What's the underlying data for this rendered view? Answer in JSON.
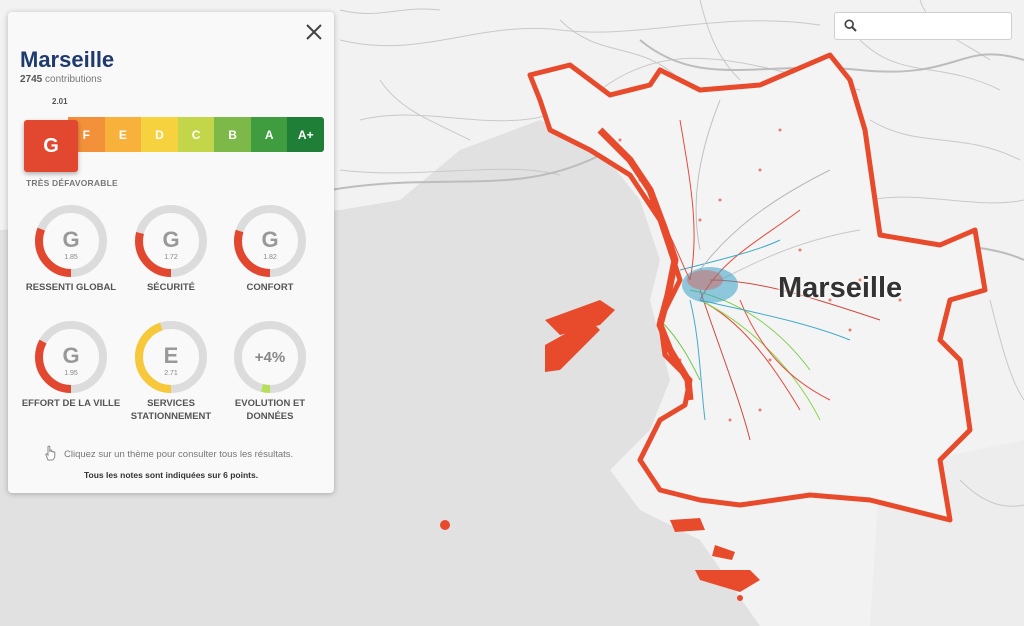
{
  "map": {
    "city_label": "Marseille",
    "boundary_color": "#e84a2c",
    "search": {
      "placeholder": "",
      "icon": "search-icon"
    }
  },
  "panel": {
    "title": "Marseille",
    "contributions_count": "2745",
    "contributions_label": "contributions",
    "score": "2.01",
    "current_grade": "G",
    "verdict": "TRÈS DÉFAVORABLE",
    "scale": [
      {
        "grade": "F",
        "color": "#f2913a"
      },
      {
        "grade": "E",
        "color": "#f8b23c"
      },
      {
        "grade": "D",
        "color": "#f6d33e"
      },
      {
        "grade": "C",
        "color": "#c3d548"
      },
      {
        "grade": "B",
        "color": "#7db949"
      },
      {
        "grade": "A",
        "color": "#3f9c3f"
      },
      {
        "grade": "A+",
        "color": "#1f7f36"
      }
    ],
    "gauges": [
      {
        "grade": "G",
        "value": "1.85",
        "label": "RESSENTI GLOBAL",
        "fraction": 0.31,
        "color": "#e2482f"
      },
      {
        "grade": "G",
        "value": "1.72",
        "label": "SÉCURITÉ",
        "fraction": 0.29,
        "color": "#e2482f"
      },
      {
        "grade": "G",
        "value": "1.82",
        "label": "CONFORT",
        "fraction": 0.3,
        "color": "#e2482f"
      },
      {
        "grade": "G",
        "value": "1.95",
        "label": "EFFORT DE LA VILLE",
        "fraction": 0.33,
        "color": "#e2482f"
      },
      {
        "grade": "E",
        "value": "2.71",
        "label": "SERVICES STATIONNEMENT",
        "fraction": 0.45,
        "color": "#f6c83a"
      },
      {
        "grade": "+4%",
        "value": "",
        "label": "EVOLUTION ET DONNÉES",
        "fraction": 0.04,
        "color": "#b7e05a"
      }
    ],
    "hint": "Cliquez sur un thème pour consulter tous les résultats.",
    "footnote": "Tous les notes sont indiquées sur 6 points."
  }
}
